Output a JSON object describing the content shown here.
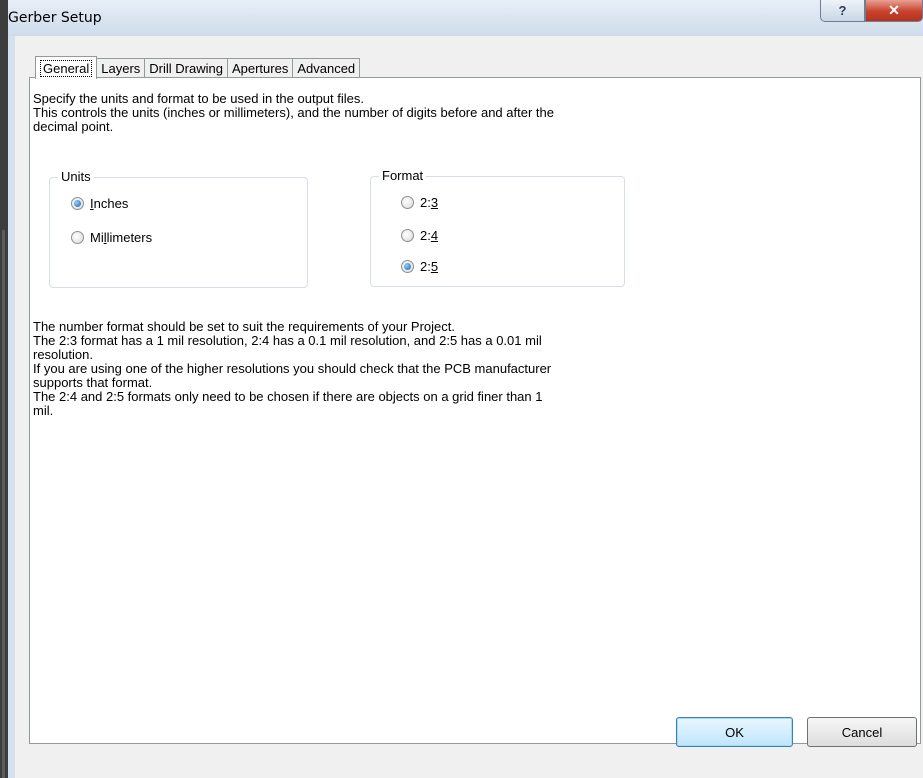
{
  "window": {
    "title": "Gerber Setup",
    "help_glyph": "?",
    "close_glyph": "✕"
  },
  "tabs": [
    {
      "label": "General",
      "active": true
    },
    {
      "label": "Layers",
      "active": false
    },
    {
      "label": "Drill Drawing",
      "active": false
    },
    {
      "label": "Apertures",
      "active": false
    },
    {
      "label": "Advanced",
      "active": false
    }
  ],
  "description": {
    "line1": "Specify the units and format to be used in the output files.",
    "line2": "This controls the units (inches or millimeters), and the number of digits before and after the",
    "line3": "decimal point."
  },
  "units": {
    "label": "Units",
    "options": [
      {
        "pre": "",
        "accel": "I",
        "post": "nches",
        "selected": true
      },
      {
        "pre": "Mi",
        "accel": "l",
        "post": "limeters",
        "selected": false
      }
    ]
  },
  "format": {
    "label": "Format",
    "options": [
      {
        "pre": "2:",
        "accel": "3",
        "post": "",
        "selected": false
      },
      {
        "pre": "2:",
        "accel": "4",
        "post": "",
        "selected": false
      },
      {
        "pre": "2:",
        "accel": "5",
        "post": "",
        "selected": true
      }
    ]
  },
  "notes": [
    "The number format should be set to suit the requirements of your Project.",
    "The 2:3 format has a 1 mil resolution, 2:4 has a 0.1 mil resolution, and 2:5 has a 0.01 mil",
    "resolution.",
    "If you are using one of the higher resolutions you should check that the PCB manufacturer",
    "supports that format.",
    "The 2:4 and 2:5 formats only need to be chosen if there are objects on a grid finer than 1",
    "mil."
  ],
  "buttons": {
    "ok": "OK",
    "cancel": "Cancel"
  }
}
